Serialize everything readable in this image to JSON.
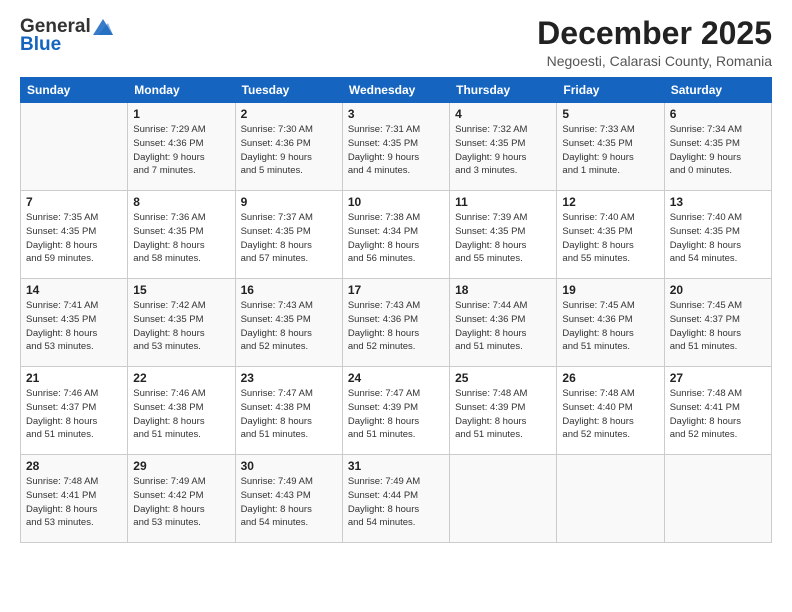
{
  "logo": {
    "general": "General",
    "blue": "Blue"
  },
  "header": {
    "month": "December 2025",
    "location": "Negoesti, Calarasi County, Romania"
  },
  "weekdays": [
    "Sunday",
    "Monday",
    "Tuesday",
    "Wednesday",
    "Thursday",
    "Friday",
    "Saturday"
  ],
  "weeks": [
    [
      {
        "day": "",
        "detail": ""
      },
      {
        "day": "1",
        "detail": "Sunrise: 7:29 AM\nSunset: 4:36 PM\nDaylight: 9 hours\nand 7 minutes."
      },
      {
        "day": "2",
        "detail": "Sunrise: 7:30 AM\nSunset: 4:36 PM\nDaylight: 9 hours\nand 5 minutes."
      },
      {
        "day": "3",
        "detail": "Sunrise: 7:31 AM\nSunset: 4:35 PM\nDaylight: 9 hours\nand 4 minutes."
      },
      {
        "day": "4",
        "detail": "Sunrise: 7:32 AM\nSunset: 4:35 PM\nDaylight: 9 hours\nand 3 minutes."
      },
      {
        "day": "5",
        "detail": "Sunrise: 7:33 AM\nSunset: 4:35 PM\nDaylight: 9 hours\nand 1 minute."
      },
      {
        "day": "6",
        "detail": "Sunrise: 7:34 AM\nSunset: 4:35 PM\nDaylight: 9 hours\nand 0 minutes."
      }
    ],
    [
      {
        "day": "7",
        "detail": "Sunrise: 7:35 AM\nSunset: 4:35 PM\nDaylight: 8 hours\nand 59 minutes."
      },
      {
        "day": "8",
        "detail": "Sunrise: 7:36 AM\nSunset: 4:35 PM\nDaylight: 8 hours\nand 58 minutes."
      },
      {
        "day": "9",
        "detail": "Sunrise: 7:37 AM\nSunset: 4:35 PM\nDaylight: 8 hours\nand 57 minutes."
      },
      {
        "day": "10",
        "detail": "Sunrise: 7:38 AM\nSunset: 4:34 PM\nDaylight: 8 hours\nand 56 minutes."
      },
      {
        "day": "11",
        "detail": "Sunrise: 7:39 AM\nSunset: 4:35 PM\nDaylight: 8 hours\nand 55 minutes."
      },
      {
        "day": "12",
        "detail": "Sunrise: 7:40 AM\nSunset: 4:35 PM\nDaylight: 8 hours\nand 55 minutes."
      },
      {
        "day": "13",
        "detail": "Sunrise: 7:40 AM\nSunset: 4:35 PM\nDaylight: 8 hours\nand 54 minutes."
      }
    ],
    [
      {
        "day": "14",
        "detail": "Sunrise: 7:41 AM\nSunset: 4:35 PM\nDaylight: 8 hours\nand 53 minutes."
      },
      {
        "day": "15",
        "detail": "Sunrise: 7:42 AM\nSunset: 4:35 PM\nDaylight: 8 hours\nand 53 minutes."
      },
      {
        "day": "16",
        "detail": "Sunrise: 7:43 AM\nSunset: 4:35 PM\nDaylight: 8 hours\nand 52 minutes."
      },
      {
        "day": "17",
        "detail": "Sunrise: 7:43 AM\nSunset: 4:36 PM\nDaylight: 8 hours\nand 52 minutes."
      },
      {
        "day": "18",
        "detail": "Sunrise: 7:44 AM\nSunset: 4:36 PM\nDaylight: 8 hours\nand 51 minutes."
      },
      {
        "day": "19",
        "detail": "Sunrise: 7:45 AM\nSunset: 4:36 PM\nDaylight: 8 hours\nand 51 minutes."
      },
      {
        "day": "20",
        "detail": "Sunrise: 7:45 AM\nSunset: 4:37 PM\nDaylight: 8 hours\nand 51 minutes."
      }
    ],
    [
      {
        "day": "21",
        "detail": "Sunrise: 7:46 AM\nSunset: 4:37 PM\nDaylight: 8 hours\nand 51 minutes."
      },
      {
        "day": "22",
        "detail": "Sunrise: 7:46 AM\nSunset: 4:38 PM\nDaylight: 8 hours\nand 51 minutes."
      },
      {
        "day": "23",
        "detail": "Sunrise: 7:47 AM\nSunset: 4:38 PM\nDaylight: 8 hours\nand 51 minutes."
      },
      {
        "day": "24",
        "detail": "Sunrise: 7:47 AM\nSunset: 4:39 PM\nDaylight: 8 hours\nand 51 minutes."
      },
      {
        "day": "25",
        "detail": "Sunrise: 7:48 AM\nSunset: 4:39 PM\nDaylight: 8 hours\nand 51 minutes."
      },
      {
        "day": "26",
        "detail": "Sunrise: 7:48 AM\nSunset: 4:40 PM\nDaylight: 8 hours\nand 52 minutes."
      },
      {
        "day": "27",
        "detail": "Sunrise: 7:48 AM\nSunset: 4:41 PM\nDaylight: 8 hours\nand 52 minutes."
      }
    ],
    [
      {
        "day": "28",
        "detail": "Sunrise: 7:48 AM\nSunset: 4:41 PM\nDaylight: 8 hours\nand 53 minutes."
      },
      {
        "day": "29",
        "detail": "Sunrise: 7:49 AM\nSunset: 4:42 PM\nDaylight: 8 hours\nand 53 minutes."
      },
      {
        "day": "30",
        "detail": "Sunrise: 7:49 AM\nSunset: 4:43 PM\nDaylight: 8 hours\nand 54 minutes."
      },
      {
        "day": "31",
        "detail": "Sunrise: 7:49 AM\nSunset: 4:44 PM\nDaylight: 8 hours\nand 54 minutes."
      },
      {
        "day": "",
        "detail": ""
      },
      {
        "day": "",
        "detail": ""
      },
      {
        "day": "",
        "detail": ""
      }
    ]
  ]
}
